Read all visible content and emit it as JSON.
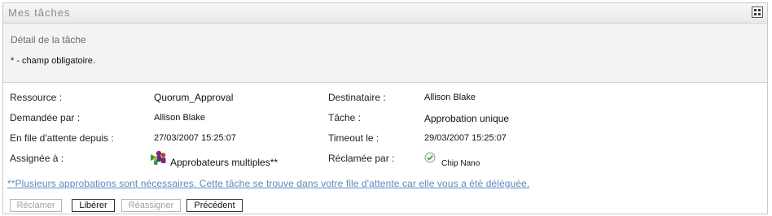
{
  "panel": {
    "title": "Mes tâches",
    "layout_icon": "grid-icon"
  },
  "detail": {
    "title": "Détail de la tâche",
    "required_note": "* - champ obligatoire."
  },
  "fields": {
    "resource_label": "Ressource :",
    "resource_value": "Quorum_Approval",
    "requested_by_label": "Demandée par :",
    "requested_by_value": "Allison Blake",
    "queued_since_label": "En file d'attente depuis :",
    "queued_since_value": "27/03/2007 15:25:07",
    "assigned_to_label": "Assignée à :",
    "assigned_to_value": "Approbateurs multiples**",
    "assigned_to_icon": "group-icon",
    "recipient_label": "Destinataire :",
    "recipient_value": "Allison Blake",
    "task_label": "Tâche :",
    "task_value": "Approbation unique",
    "timeout_label": "Timeout le :",
    "timeout_value": "29/03/2007 15:25:07",
    "claimed_by_label": "Réclamée par :",
    "claimed_by_value": "Chip Nano",
    "claimed_by_icon": "check-icon"
  },
  "note": "**Plusieurs approbations sont nécessaires. Cette tâche se trouve dans votre file d'attente car elle vous a été déléguée.",
  "buttons": {
    "claim": "Réclamer",
    "release": "Libérer",
    "reassign": "Réassigner",
    "previous": "Précédent"
  },
  "colors": {
    "link": "#5a8bbd",
    "disabled_text": "#a0a0a0"
  }
}
